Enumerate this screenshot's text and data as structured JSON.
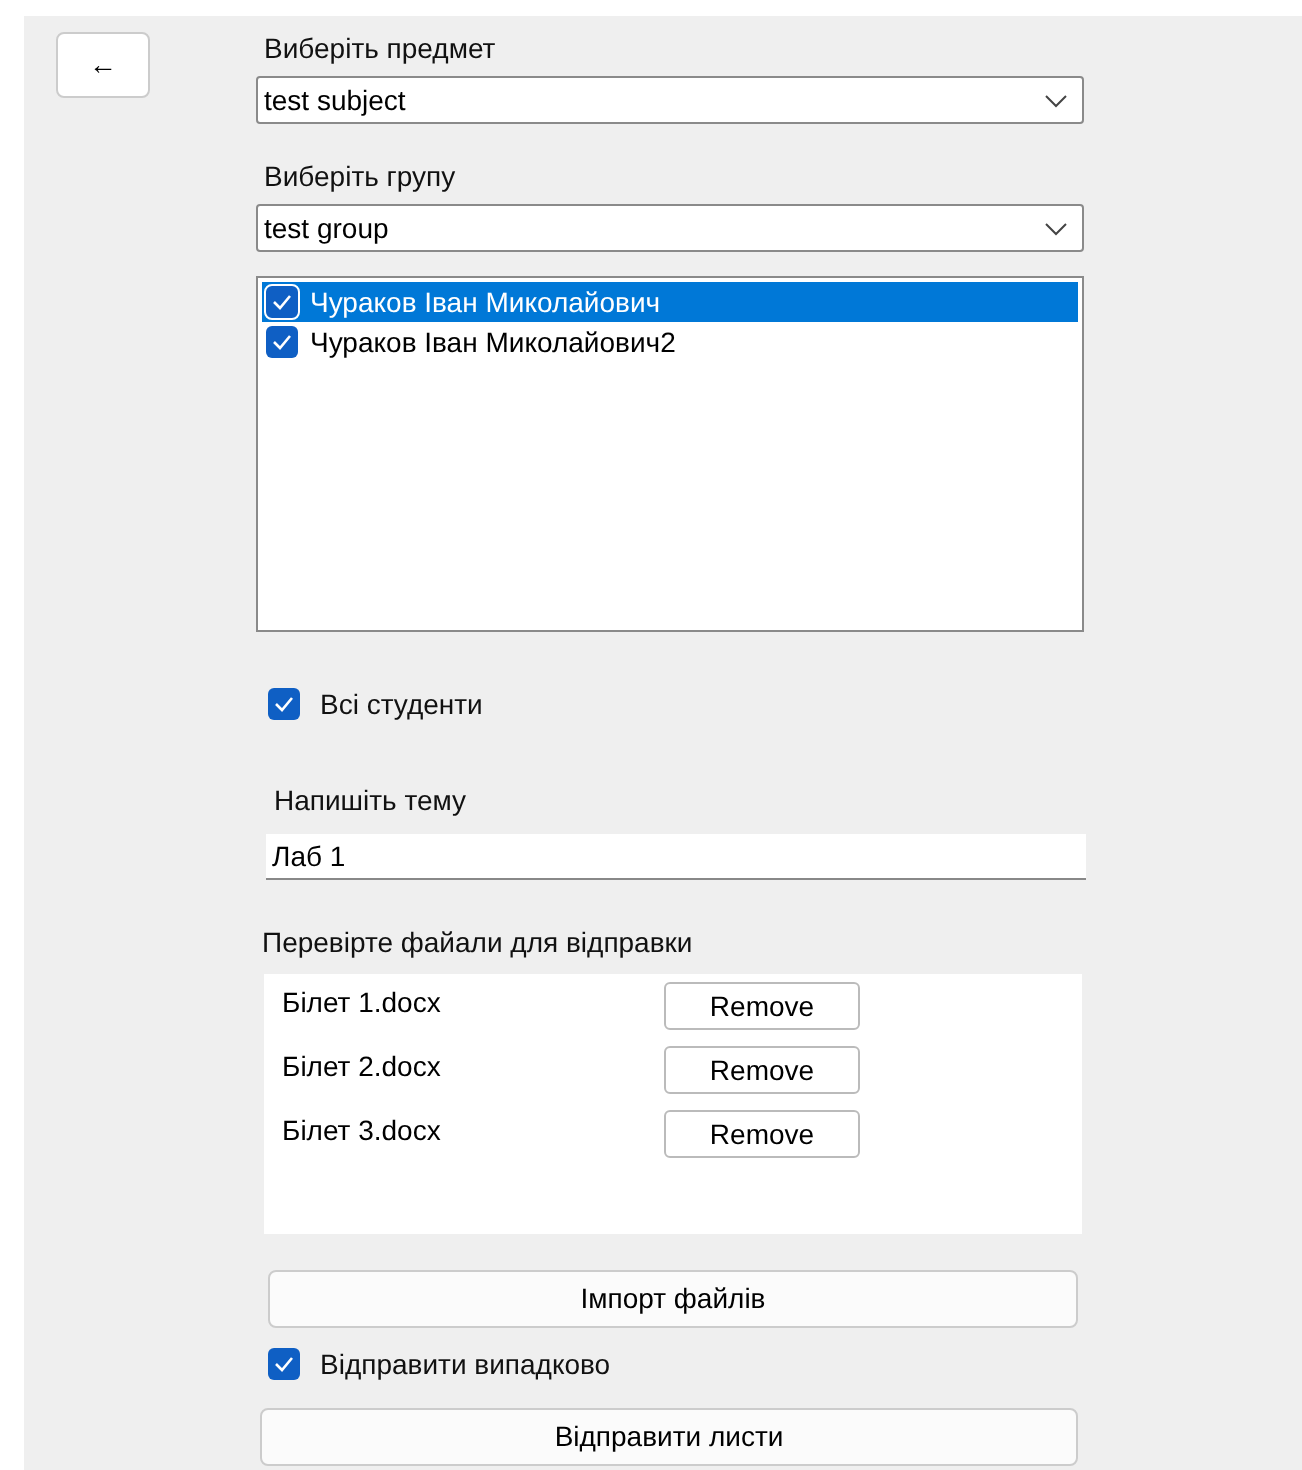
{
  "back_button": {
    "label": "←"
  },
  "subject": {
    "label": "Виберіть предмет",
    "value": "test subject"
  },
  "group": {
    "label": "Виберіть групу",
    "value": "test group"
  },
  "students": [
    {
      "name": "Чураков Іван Миколайович",
      "checked": true,
      "selected": true
    },
    {
      "name": "Чураков Іван Миколайович2",
      "checked": true,
      "selected": false
    }
  ],
  "all_students": {
    "label": "Всі студенти",
    "checked": true
  },
  "topic": {
    "label": "Напишіть тему",
    "value": "Лаб 1"
  },
  "files": {
    "label": "Перевірте файали для відправки",
    "items": [
      {
        "name": "Білет 1.docx",
        "button": "Remove"
      },
      {
        "name": "Білет 2.docx",
        "button": "Remove"
      },
      {
        "name": "Білет 3.docx",
        "button": "Remove"
      }
    ]
  },
  "import_button": "Імпорт файлів",
  "random_send": {
    "label": "Відправити випадково",
    "checked": true
  },
  "send_button": "Відправити листи"
}
